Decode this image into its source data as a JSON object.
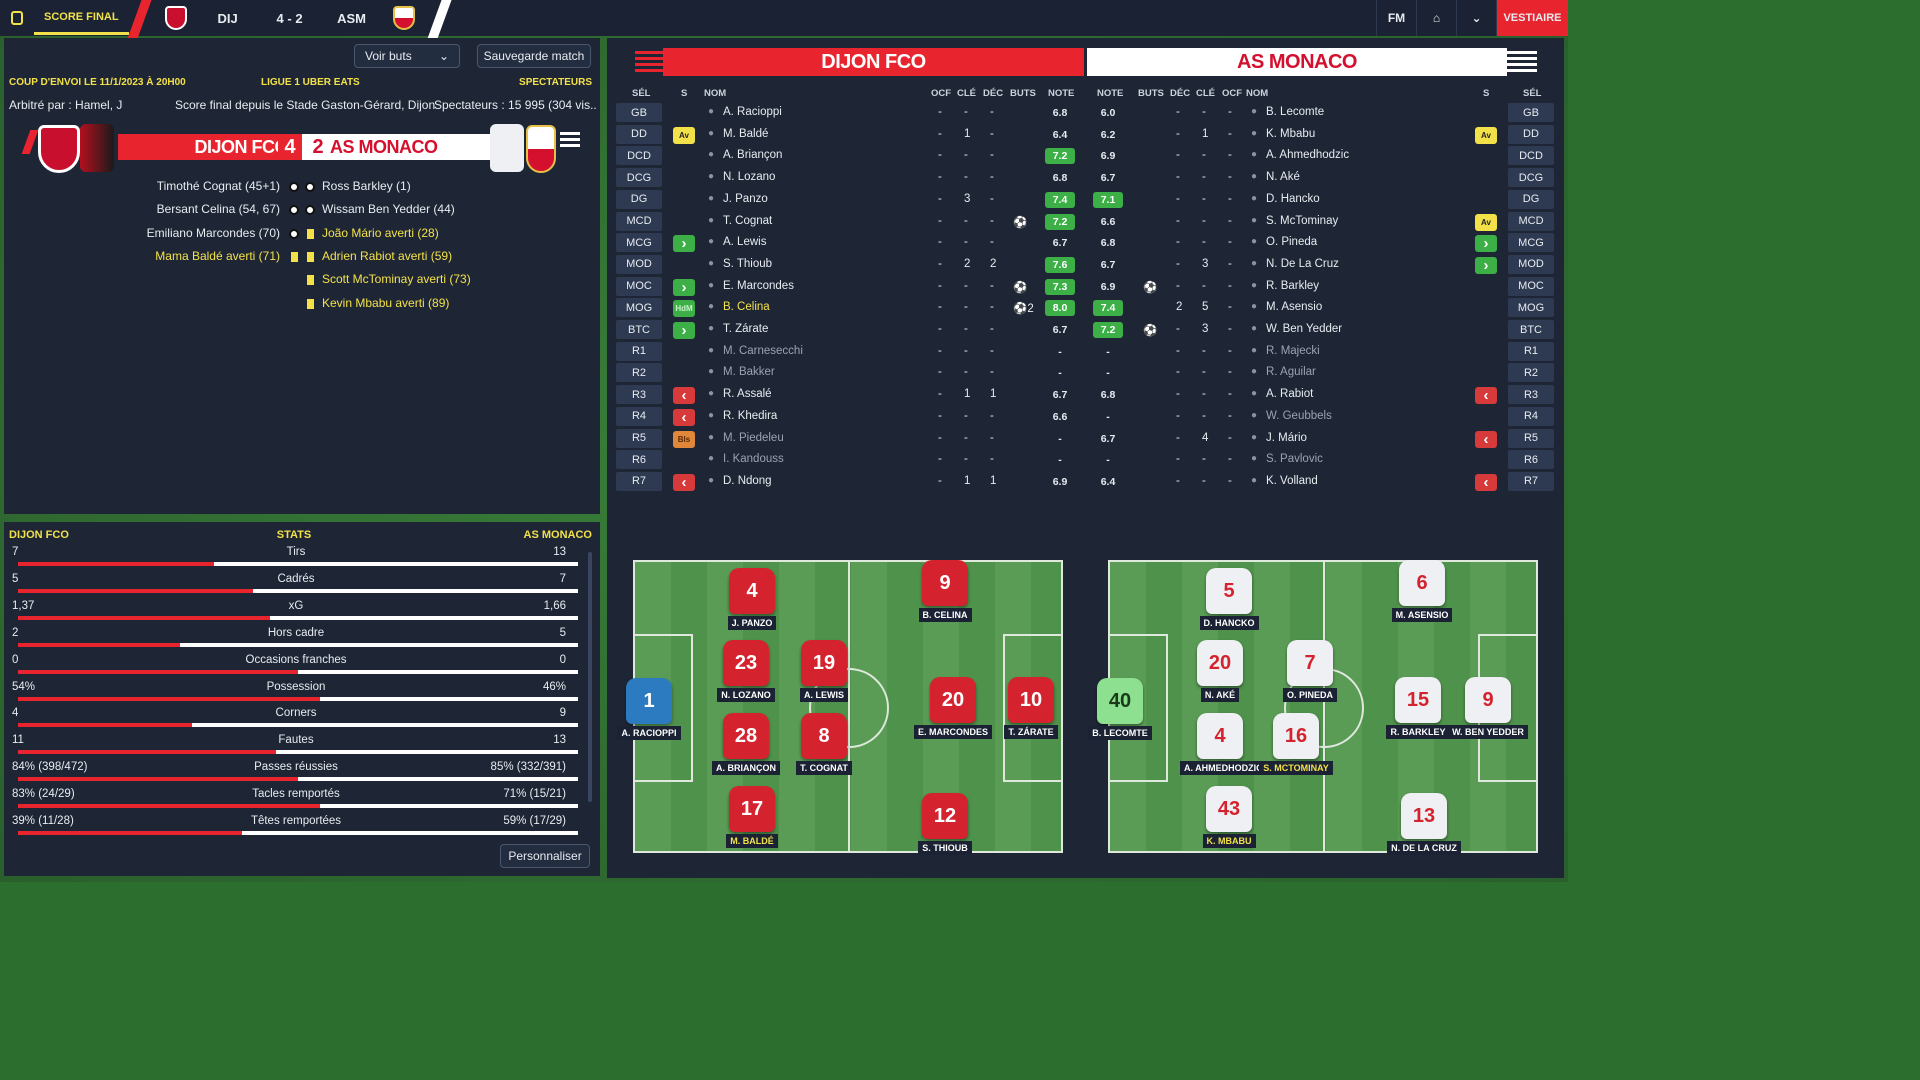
{
  "top": {
    "score_final": "SCORE FINAL",
    "home": "DIJ",
    "score": "4 - 2",
    "away": "ASM",
    "fm": "FM",
    "vestiaire": "VESTIAIRE"
  },
  "left": {
    "voir_buts": "Voir buts",
    "sauvegarde": "Sauvegarde match",
    "kickoff": "COUP D'ENVOI LE 11/1/2023 À 20H00",
    "league": "LIGUE 1 UBER EATS",
    "spect_label": "SPECTATEURS",
    "referee": "Arbitré par : Hamel, J",
    "venue": "Score final depuis le Stade Gaston-Gérard, Dijon",
    "spectators": "Spectateurs : 15 995 (304 vis...",
    "home_name": "DIJON FCO",
    "home_score": "4",
    "away_score": "2",
    "away_name": "AS MONACO",
    "events_left": [
      {
        "t": "Timothé Cognat (45+1)",
        "y": false
      },
      {
        "t": "Bersant Celina (54, 67)",
        "y": false
      },
      {
        "t": "Emiliano Marcondes (70)",
        "y": false
      },
      {
        "t": "Mama Baldé averti (71)",
        "y": true
      }
    ],
    "events_right": [
      {
        "t": "Ross Barkley (1)",
        "y": false
      },
      {
        "t": "Wissam Ben Yedder (44)",
        "y": false
      },
      {
        "t": "João Mário averti (28)",
        "y": true
      },
      {
        "t": "Adrien Rabiot averti (59)",
        "y": true
      },
      {
        "t": "Scott McTominay averti (73)",
        "y": true
      },
      {
        "t": "Kevin Mbabu averti (89)",
        "y": true
      }
    ]
  },
  "stats": {
    "home": "DIJON FCO",
    "title": "STATS",
    "away": "AS MONACO",
    "personnaliser": "Personnaliser",
    "rows": [
      {
        "l": "7",
        "n": "Tirs",
        "r": "13",
        "p": 35
      },
      {
        "l": "5",
        "n": "Cadrés",
        "r": "7",
        "p": 42
      },
      {
        "l": "1,37",
        "n": "xG",
        "r": "1,66",
        "p": 45
      },
      {
        "l": "2",
        "n": "Hors cadre",
        "r": "5",
        "p": 29
      },
      {
        "l": "0",
        "n": "Occasions franches",
        "r": "0",
        "p": 50
      },
      {
        "l": "54%",
        "n": "Possession",
        "r": "46%",
        "p": 54
      },
      {
        "l": "4",
        "n": "Corners",
        "r": "9",
        "p": 31
      },
      {
        "l": "11",
        "n": "Fautes",
        "r": "13",
        "p": 46
      },
      {
        "l": "84% (398/472)",
        "n": "Passes réussies",
        "r": "85% (332/391)",
        "p": 50
      },
      {
        "l": "83% (24/29)",
        "n": "Tacles remportés",
        "r": "71% (15/21)",
        "p": 54
      },
      {
        "l": "39% (11/28)",
        "n": "Têtes remportées",
        "r": "59% (17/29)",
        "p": 40
      }
    ]
  },
  "table": {
    "home": "DIJON FCO",
    "away": "AS MONACO",
    "cols": {
      "sel": "SÉL",
      "s": "S",
      "nom": "NOM",
      "ocf": "OCF",
      "cle": "CLÉ",
      "dec": "DÉC",
      "buts": "BUTS",
      "note": "NOTE"
    },
    "rows": [
      {
        "pos": "GB",
        "hs": "",
        "hn": "A. Racioppi",
        "ho": "-",
        "hc": "-",
        "hd": "-",
        "hb": "",
        "hr": "6.8",
        "ar": "6.0",
        "ab": "",
        "ad": "-",
        "ac": "-",
        "ao": "-",
        "an": "B. Lecomte",
        "as": ""
      },
      {
        "pos": "DD",
        "hs": "Av",
        "hn": "M. Baldé",
        "ho": "-",
        "hc": "1",
        "hd": "-",
        "hb": "",
        "hr": "6.4",
        "ar": "6.2",
        "ab": "",
        "ad": "-",
        "ac": "1",
        "ao": "-",
        "an": "K. Mbabu",
        "as": "Av"
      },
      {
        "pos": "DCD",
        "hs": "",
        "hn": "A. Briançon",
        "ho": "-",
        "hc": "-",
        "hd": "-",
        "hb": "",
        "hr": "7.2",
        "ar": "6.9",
        "ab": "",
        "ad": "-",
        "ac": "-",
        "ao": "-",
        "an": "A. Ahmedhodzic",
        "as": ""
      },
      {
        "pos": "DCG",
        "hs": "",
        "hn": "N. Lozano",
        "ho": "-",
        "hc": "-",
        "hd": "-",
        "hb": "",
        "hr": "6.8",
        "ar": "6.7",
        "ab": "",
        "ad": "-",
        "ac": "-",
        "ao": "-",
        "an": "N. Aké",
        "as": ""
      },
      {
        "pos": "DG",
        "hs": "",
        "hn": "J. Panzo",
        "ho": "-",
        "hc": "3",
        "hd": "-",
        "hb": "",
        "hr": "7.4",
        "ar": "7.1",
        "ab": "",
        "ad": "-",
        "ac": "-",
        "ao": "-",
        "an": "D. Hancko",
        "as": ""
      },
      {
        "pos": "MCD",
        "hs": "",
        "hn": "T. Cognat",
        "ho": "-",
        "hc": "-",
        "hd": "-",
        "hb": "⚽",
        "hr": "7.2",
        "ar": "6.6",
        "ab": "",
        "ad": "-",
        "ac": "-",
        "ao": "-",
        "an": "S. McTominay",
        "as": "Av"
      },
      {
        "pos": "MCG",
        "hs": ">",
        "hn": "A. Lewis",
        "ho": "-",
        "hc": "-",
        "hd": "-",
        "hb": "",
        "hr": "6.7",
        "ar": "6.8",
        "ab": "",
        "ad": "-",
        "ac": "-",
        "ao": "-",
        "an": "O. Pineda",
        "as": ">"
      },
      {
        "pos": "MOD",
        "hs": "",
        "hn": "S. Thioub",
        "ho": "-",
        "hc": "2",
        "hd": "2",
        "hb": "",
        "hr": "7.6",
        "ar": "6.7",
        "ab": "",
        "ad": "-",
        "ac": "3",
        "ao": "-",
        "an": "N. De La Cruz",
        "as": ">"
      },
      {
        "pos": "MOC",
        "hs": ">",
        "hn": "E. Marcondes",
        "ho": "-",
        "hc": "-",
        "hd": "-",
        "hb": "⚽",
        "hr": "7.3",
        "ar": "6.9",
        "ab": "⚽",
        "ad": "-",
        "ac": "-",
        "ao": "-",
        "an": "R. Barkley",
        "as": ""
      },
      {
        "pos": "MOG",
        "hs": "HdM",
        "hn": "B. Celina",
        "ho": "-",
        "hc": "-",
        "hd": "-",
        "hb": "⚽2",
        "hr": "8.0",
        "ar": "7.4",
        "ab": "",
        "ad": "2",
        "ac": "5",
        "ao": "-",
        "an": "M. Asensio",
        "as": ""
      },
      {
        "pos": "BTC",
        "hs": ">",
        "hn": "T. Zárate",
        "ho": "-",
        "hc": "-",
        "hd": "-",
        "hb": "",
        "hr": "6.7",
        "ar": "7.2",
        "ab": "⚽",
        "ad": "-",
        "ac": "3",
        "ao": "-",
        "an": "W. Ben Yedder",
        "as": ""
      },
      {
        "pos": "R1",
        "hs": "",
        "hn": "M. Carnesecchi",
        "ho": "-",
        "hc": "-",
        "hd": "-",
        "hb": "",
        "hr": "-",
        "ar": "-",
        "ab": "",
        "ad": "-",
        "ac": "-",
        "ao": "-",
        "an": "R. Majecki",
        "as": ""
      },
      {
        "pos": "R2",
        "hs": "",
        "hn": "M. Bakker",
        "ho": "-",
        "hc": "-",
        "hd": "-",
        "hb": "",
        "hr": "-",
        "ar": "-",
        "ab": "",
        "ad": "-",
        "ac": "-",
        "ao": "-",
        "an": "R. Aguilar",
        "as": ""
      },
      {
        "pos": "R3",
        "hs": "<",
        "hn": "R. Assalé",
        "ho": "-",
        "hc": "1",
        "hd": "1",
        "hb": "",
        "hr": "6.7",
        "ar": "6.8",
        "ab": "",
        "ad": "-",
        "ac": "-",
        "ao": "-",
        "an": "A. Rabiot",
        "as": "<"
      },
      {
        "pos": "R4",
        "hs": "<",
        "hn": "R. Khedira",
        "ho": "-",
        "hc": "-",
        "hd": "-",
        "hb": "",
        "hr": "6.6",
        "ar": "-",
        "ab": "",
        "ad": "-",
        "ac": "-",
        "ao": "-",
        "an": "W. Geubbels",
        "as": ""
      },
      {
        "pos": "R5",
        "hs": "Bls",
        "hn": "M. Piedeleu",
        "ho": "-",
        "hc": "-",
        "hd": "-",
        "hb": "",
        "hr": "-",
        "ar": "6.7",
        "ab": "",
        "ad": "-",
        "ac": "4",
        "ao": "-",
        "an": "J. Mário",
        "as": "<"
      },
      {
        "pos": "R6",
        "hs": "",
        "hn": "I. Kandouss",
        "ho": "-",
        "hc": "-",
        "hd": "-",
        "hb": "",
        "hr": "-",
        "ar": "-",
        "ab": "",
        "ad": "-",
        "ac": "-",
        "ao": "-",
        "an": "S. Pavlovic",
        "as": ""
      },
      {
        "pos": "R7",
        "hs": "<",
        "hn": "D. Ndong",
        "ho": "-",
        "hc": "1",
        "hd": "1",
        "hb": "",
        "hr": "6.9",
        "ar": "6.4",
        "ab": "",
        "ad": "-",
        "ac": "-",
        "ao": "-",
        "an": "K. Volland",
        "as": "<"
      }
    ]
  },
  "pitch_home": [
    {
      "n": "1",
      "name": "A. RACIOPPI",
      "k": "gk",
      "y": false
    },
    {
      "n": "4",
      "name": "J. PANZO",
      "k": "r",
      "y": false
    },
    {
      "n": "23",
      "name": "N. LOZANO",
      "k": "r",
      "y": false
    },
    {
      "n": "28",
      "name": "A. BRIANÇON",
      "k": "r",
      "y": false
    },
    {
      "n": "17",
      "name": "M. BALDÉ",
      "k": "r",
      "y": true
    },
    {
      "n": "19",
      "name": "A. LEWIS",
      "k": "r",
      "y": false
    },
    {
      "n": "8",
      "name": "T. COGNAT",
      "k": "r",
      "y": false
    },
    {
      "n": "9",
      "name": "B. CELINA",
      "k": "r",
      "y": false
    },
    {
      "n": "20",
      "name": "E. MARCONDES",
      "k": "r",
      "y": false
    },
    {
      "n": "12",
      "name": "S. THIOUB",
      "k": "r",
      "y": false
    },
    {
      "n": "10",
      "name": "T. ZÁRATE",
      "k": "r",
      "y": false
    }
  ],
  "pitch_away": [
    {
      "n": "40",
      "name": "B. LECOMTE",
      "k": "gk2",
      "y": false
    },
    {
      "n": "5",
      "name": "D. HANCKO",
      "k": "w",
      "y": false
    },
    {
      "n": "20",
      "name": "N. AKÉ",
      "k": "w",
      "y": false
    },
    {
      "n": "4",
      "name": "A. AHMEDHODZIC",
      "k": "w",
      "y": false
    },
    {
      "n": "43",
      "name": "K. MBABU",
      "k": "w",
      "y": true
    },
    {
      "n": "7",
      "name": "O. PINEDA",
      "k": "w",
      "y": false
    },
    {
      "n": "16",
      "name": "S. MCTOMINAY",
      "k": "w",
      "y": true
    },
    {
      "n": "6",
      "name": "M. ASENSIO",
      "k": "w",
      "y": false
    },
    {
      "n": "15",
      "name": "R. BARKLEY",
      "k": "w",
      "y": false
    },
    {
      "n": "9",
      "name": "W. BEN YEDDER",
      "k": "w",
      "y": false
    },
    {
      "n": "13",
      "name": "N. DE LA CRUZ",
      "k": "w",
      "y": false
    }
  ]
}
